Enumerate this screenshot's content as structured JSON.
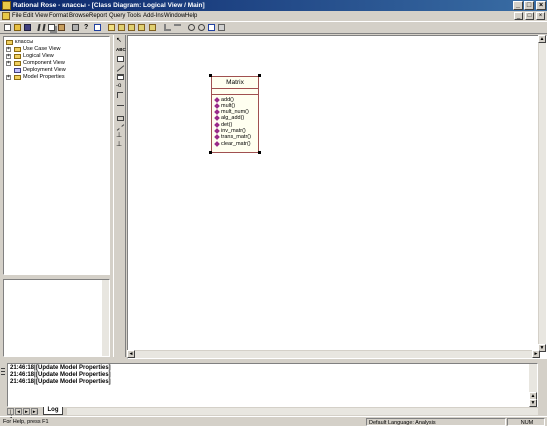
{
  "window": {
    "title": "Rational Rose - классы - [Class Diagram: Logical View / Main]",
    "minimize_glyph": "_",
    "maximize_glyph": "□",
    "close_glyph": "×"
  },
  "menu": {
    "items": [
      "File",
      "Edit",
      "View",
      "Format",
      "Browse",
      "Report",
      "Query",
      "Tools",
      "Add-Ins",
      "Window",
      "Help"
    ]
  },
  "toolbar": {
    "icons": [
      "new-icon",
      "open-icon",
      "save-icon",
      "cut-icon",
      "copy-icon",
      "paste-icon",
      "print-icon",
      "context-help-icon",
      "view-doc-icon",
      "browse-class-diagram-icon",
      "browse-interaction-diagram-icon",
      "browse-component-diagram-icon",
      "browse-deployment-diagram-icon",
      "browse-parent-icon",
      "browse-previous-icon",
      "zoom-in-icon",
      "zoom-out-icon",
      "fit-in-window-icon",
      "undo-fit-icon"
    ]
  },
  "tree": {
    "root": "классы",
    "items": [
      {
        "label": "Use Case View",
        "expander": "+"
      },
      {
        "label": "Logical View",
        "expander": "+"
      },
      {
        "label": "Component View",
        "expander": "+"
      },
      {
        "label": "Deployment View",
        "expander": ""
      },
      {
        "label": "Model Properties",
        "expander": "+"
      }
    ]
  },
  "toolbox": {
    "tools": [
      "selection-icon",
      "text-box-icon",
      "note-icon",
      "anchor-note-icon",
      "class-icon",
      "interface-icon",
      "association-icon",
      "unidirectional-association-icon",
      "package-icon",
      "dependency-icon",
      "generalization-icon",
      "realize-icon"
    ],
    "text_tool_label": "ABC"
  },
  "diagram": {
    "class_name": "Matrix",
    "operations": [
      "add()",
      "mult()",
      "mult_num()",
      "alg_add()",
      "det()",
      "inv_matr()",
      "trans_matr()",
      "clear_matr()"
    ]
  },
  "log": {
    "lines": [
      {
        "time": "21:46:18|",
        "message": "[Update Model Properties]"
      },
      {
        "time": "21:46:18|",
        "message": "[Update Model Properties]"
      },
      {
        "time": "21:46:18|",
        "message": "[Update Model Properties]"
      }
    ],
    "tab_label": "Log",
    "nav_buttons": [
      "|◄",
      "◄",
      "►",
      "►|"
    ]
  },
  "status": {
    "help": "For Help, press F1",
    "language": "Default Language: Analysis",
    "num": "NUM"
  },
  "colors": {
    "titlebar_start": "#0a246a",
    "titlebar_end": "#3a6ea5",
    "class_fill": "#fffff0",
    "class_border": "#a05050",
    "operation_marker": "#9a2a8a"
  }
}
